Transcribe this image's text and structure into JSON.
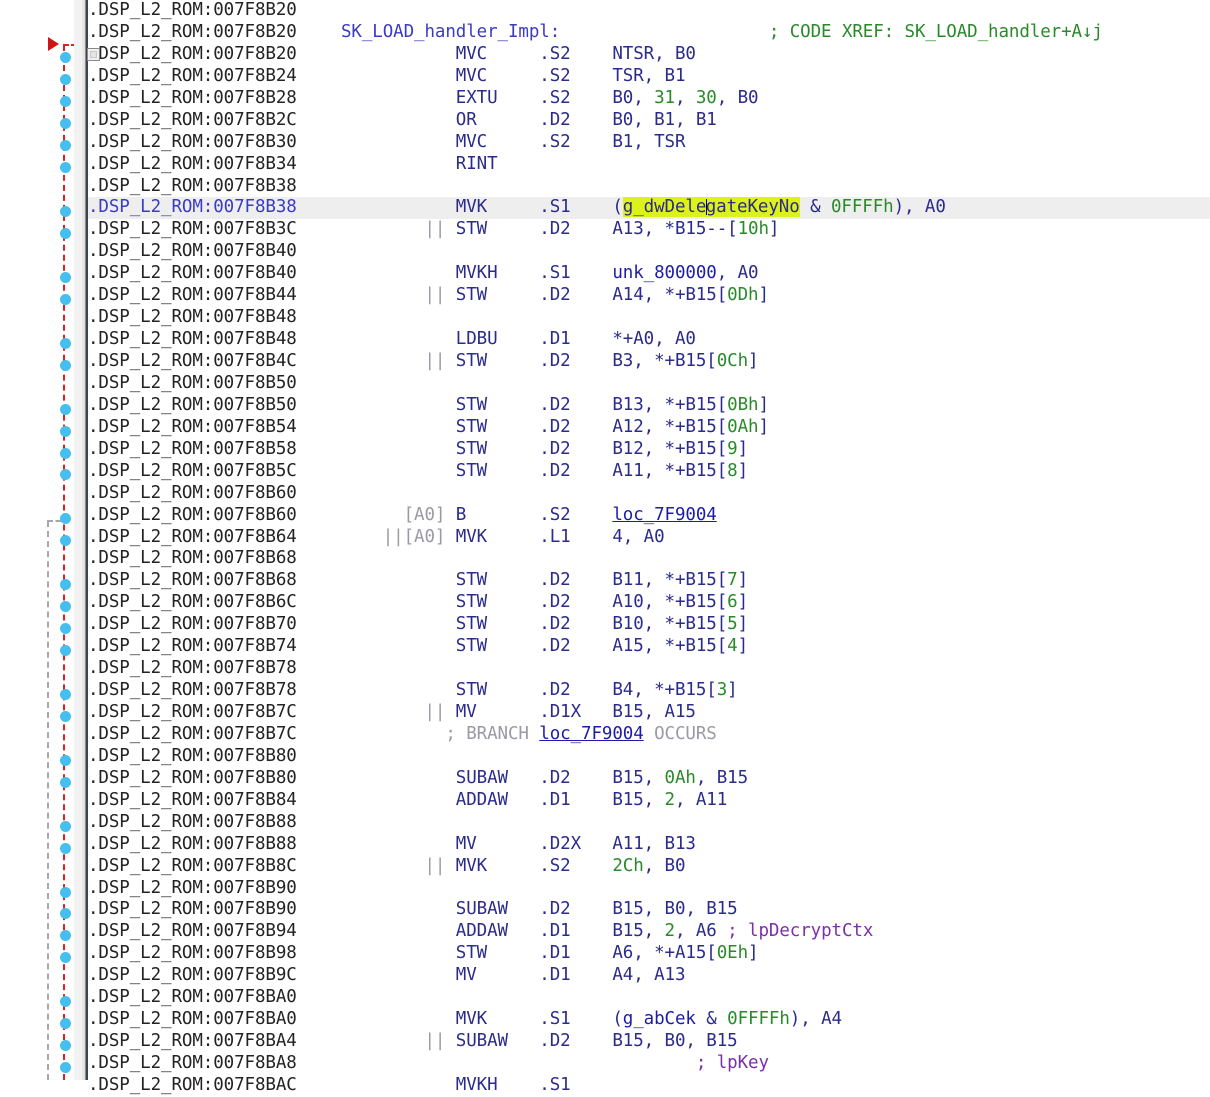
{
  "window": {
    "app": "IDA Pro disassembly view",
    "segment_prefix": ".DSP_L2_ROM:"
  },
  "gutter": {
    "arrow_red_name": "jump-arrow-incoming",
    "arrow_gray_name": "jump-arrow-secondary",
    "dot_rows": [
      2,
      3,
      4,
      5,
      6,
      7,
      9,
      10,
      12,
      13,
      15,
      16,
      18,
      19,
      20,
      21,
      23,
      24,
      26,
      27,
      28,
      29,
      31,
      32,
      34,
      35,
      37,
      38,
      40,
      41,
      42,
      43,
      45,
      46,
      47,
      48
    ]
  },
  "selection": {
    "highlighted_token": "g_dwDelegateKeyNo",
    "caret_after": "g_dwDele",
    "caret_before": "gateKeyNo",
    "current_line_index": 9
  },
  "lines": [
    {
      "addr": "007F8B20",
      "parallel": "",
      "mnemonic": "",
      "unit": "",
      "operands": "",
      "comment": ""
    },
    {
      "addr": "007F8B20",
      "label": "SK_LOAD_handler_Impl:",
      "comment": "; CODE XREF: SK_LOAD_handler+A↓j"
    },
    {
      "addr": "007F8B20",
      "parallel": "",
      "mnemonic": "MVC",
      "unit": ".S2",
      "operands": "NTSR, B0",
      "collapse": true
    },
    {
      "addr": "007F8B24",
      "parallel": "",
      "mnemonic": "MVC",
      "unit": ".S2",
      "operands": "TSR, B1"
    },
    {
      "addr": "007F8B28",
      "parallel": "",
      "mnemonic": "EXTU",
      "unit": ".S2",
      "operands": "B0, 31, 30, B0"
    },
    {
      "addr": "007F8B2C",
      "parallel": "",
      "mnemonic": "OR",
      "unit": ".D2",
      "operands": "B0, B1, B1"
    },
    {
      "addr": "007F8B30",
      "parallel": "",
      "mnemonic": "MVC",
      "unit": ".S2",
      "operands": "B1, TSR"
    },
    {
      "addr": "007F8B34",
      "parallel": "",
      "mnemonic": "RINT",
      "unit": "",
      "operands": ""
    },
    {
      "addr": "007F8B38",
      "parallel": "",
      "mnemonic": "",
      "unit": "",
      "operands": ""
    },
    {
      "addr": "007F8B38",
      "parallel": "",
      "mnemonic": "MVK",
      "unit": ".S1",
      "operands": "(g_dwDelegateKeyNo & 0FFFFh), A0",
      "current": true
    },
    {
      "addr": "007F8B3C",
      "parallel": "||",
      "mnemonic": "STW",
      "unit": ".D2",
      "operands": "A13, *B15--[10h]"
    },
    {
      "addr": "007F8B40",
      "parallel": "",
      "mnemonic": "",
      "unit": "",
      "operands": ""
    },
    {
      "addr": "007F8B40",
      "parallel": "",
      "mnemonic": "MVKH",
      "unit": ".S1",
      "operands": "unk_800000, A0"
    },
    {
      "addr": "007F8B44",
      "parallel": "||",
      "mnemonic": "STW",
      "unit": ".D2",
      "operands": "A14, *+B15[0Dh]"
    },
    {
      "addr": "007F8B48",
      "parallel": "",
      "mnemonic": "",
      "unit": "",
      "operands": ""
    },
    {
      "addr": "007F8B48",
      "parallel": "",
      "mnemonic": "LDBU",
      "unit": ".D1",
      "operands": "*+A0, A0"
    },
    {
      "addr": "007F8B4C",
      "parallel": "||",
      "mnemonic": "STW",
      "unit": ".D2",
      "operands": "B3, *+B15[0Ch]"
    },
    {
      "addr": "007F8B50",
      "parallel": "",
      "mnemonic": "",
      "unit": "",
      "operands": ""
    },
    {
      "addr": "007F8B50",
      "parallel": "",
      "mnemonic": "STW",
      "unit": ".D2",
      "operands": "B13, *+B15[0Bh]"
    },
    {
      "addr": "007F8B54",
      "parallel": "",
      "mnemonic": "STW",
      "unit": ".D2",
      "operands": "A12, *+B15[0Ah]"
    },
    {
      "addr": "007F8B58",
      "parallel": "",
      "mnemonic": "STW",
      "unit": ".D2",
      "operands": "B12, *+B15[9]"
    },
    {
      "addr": "007F8B5C",
      "parallel": "",
      "mnemonic": "STW",
      "unit": ".D2",
      "operands": "A11, *+B15[8]"
    },
    {
      "addr": "007F8B60",
      "parallel": "",
      "mnemonic": "",
      "unit": "",
      "operands": ""
    },
    {
      "addr": "007F8B60",
      "parallel": "",
      "pred": "[A0]",
      "mnemonic": "B",
      "unit": ".S2",
      "operands": "loc_7F9004"
    },
    {
      "addr": "007F8B64",
      "parallel": "||",
      "pred": "[A0]",
      "mnemonic": "MVK",
      "unit": ".L1",
      "operands": "4, A0"
    },
    {
      "addr": "007F8B68",
      "parallel": "",
      "mnemonic": "",
      "unit": "",
      "operands": ""
    },
    {
      "addr": "007F8B68",
      "parallel": "",
      "mnemonic": "STW",
      "unit": ".D2",
      "operands": "B11, *+B15[7]"
    },
    {
      "addr": "007F8B6C",
      "parallel": "",
      "mnemonic": "STW",
      "unit": ".D2",
      "operands": "A10, *+B15[6]"
    },
    {
      "addr": "007F8B70",
      "parallel": "",
      "mnemonic": "STW",
      "unit": ".D2",
      "operands": "B10, *+B15[5]"
    },
    {
      "addr": "007F8B74",
      "parallel": "",
      "mnemonic": "STW",
      "unit": ".D2",
      "operands": "A15, *+B15[4]"
    },
    {
      "addr": "007F8B78",
      "parallel": "",
      "mnemonic": "",
      "unit": "",
      "operands": ""
    },
    {
      "addr": "007F8B78",
      "parallel": "",
      "mnemonic": "STW",
      "unit": ".D2",
      "operands": "B4, *+B15[3]"
    },
    {
      "addr": "007F8B7C",
      "parallel": "||",
      "mnemonic": "MV",
      "unit": ".D1X",
      "operands": "B15, A15"
    },
    {
      "addr": "007F8B7C",
      "branch_note": "; BRANCH loc_7F9004 OCCURS"
    },
    {
      "addr": "007F8B80",
      "parallel": "",
      "mnemonic": "",
      "unit": "",
      "operands": ""
    },
    {
      "addr": "007F8B80",
      "parallel": "",
      "mnemonic": "SUBAW",
      "unit": ".D2",
      "operands": "B15, 0Ah, B15"
    },
    {
      "addr": "007F8B84",
      "parallel": "",
      "mnemonic": "ADDAW",
      "unit": ".D1",
      "operands": "B15, 2, A11"
    },
    {
      "addr": "007F8B88",
      "parallel": "",
      "mnemonic": "",
      "unit": "",
      "operands": ""
    },
    {
      "addr": "007F8B88",
      "parallel": "",
      "mnemonic": "MV",
      "unit": ".D2X",
      "operands": "A11, B13"
    },
    {
      "addr": "007F8B8C",
      "parallel": "||",
      "mnemonic": "MVK",
      "unit": ".S2",
      "operands": "2Ch, B0"
    },
    {
      "addr": "007F8B90",
      "parallel": "",
      "mnemonic": "",
      "unit": "",
      "operands": ""
    },
    {
      "addr": "007F8B90",
      "parallel": "",
      "mnemonic": "SUBAW",
      "unit": ".D2",
      "operands": "B15, B0, B15"
    },
    {
      "addr": "007F8B94",
      "parallel": "",
      "mnemonic": "ADDAW",
      "unit": ".D1",
      "operands": "B15, 2, A6 ; lpDecryptCtx"
    },
    {
      "addr": "007F8B98",
      "parallel": "",
      "mnemonic": "STW",
      "unit": ".D1",
      "operands": "A6, *+A15[0Eh]"
    },
    {
      "addr": "007F8B9C",
      "parallel": "",
      "mnemonic": "MV",
      "unit": ".D1",
      "operands": "A4, A13"
    },
    {
      "addr": "007F8BA0",
      "parallel": "",
      "mnemonic": "",
      "unit": "",
      "operands": ""
    },
    {
      "addr": "007F8BA0",
      "parallel": "",
      "mnemonic": "MVK",
      "unit": ".S1",
      "operands": "(g_abCek & 0FFFFh), A4"
    },
    {
      "addr": "007F8BA4",
      "parallel": "||",
      "mnemonic": "SUBAW",
      "unit": ".D2",
      "operands": "B15, B0, B15"
    },
    {
      "addr": "007F8BA8",
      "trailing_comment": "; lpKey"
    },
    {
      "addr": "007F8BAC",
      "clipped": true,
      "parallel": "",
      "mnemonic": "MVKH",
      "unit": ".S1",
      "operands": "",
      "comment": ""
    }
  ],
  "colors": {
    "address": "#232323",
    "current_address": "#3b3bc4",
    "mnemonic": "#2b2b8c",
    "number": "#2a8a2a",
    "label": "#1c1ca8",
    "function_name": "#3b3bc4",
    "comment": "#2a8a2a",
    "branch_comment": "#9a9aa5",
    "named_arg_comment": "#7b2fa8",
    "highlight_background": "#ddf21a",
    "current_row_background": "#eeeeee",
    "jump_arrow": "#e02020",
    "jump_arrow_secondary": "#a8a8a8",
    "marker_dot": "#45bff0"
  }
}
